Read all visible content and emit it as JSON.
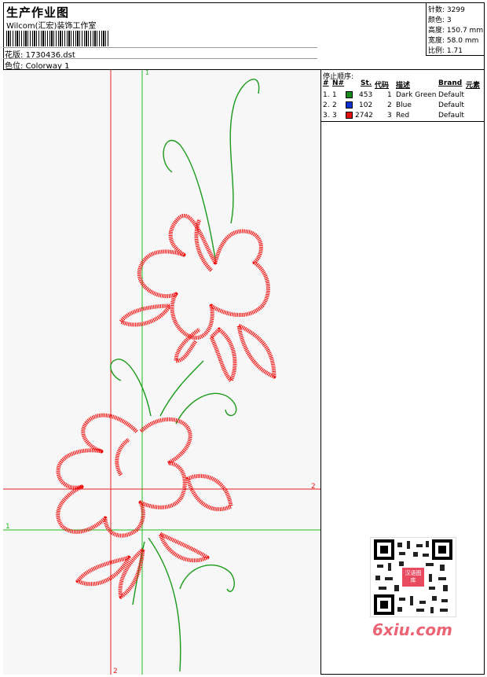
{
  "header": {
    "title": "生产作业图",
    "company": "Wilcom(汇宏)装饰工作室",
    "design_label": "花版:",
    "design_value": "1730436.dst",
    "color_label": "色位:",
    "color_value": "Colorway 1"
  },
  "stats": [
    {
      "label": "针数:",
      "value": "3299"
    },
    {
      "label": "颜色:",
      "value": "3"
    },
    {
      "label": "高度:",
      "value": "150.7 mm"
    },
    {
      "label": "宽度:",
      "value": "58.0 mm"
    },
    {
      "label": "比例:",
      "value": "1.71"
    }
  ],
  "markers": {
    "green_v": "1",
    "red_h": "2",
    "green_h": "1",
    "red_v": "2"
  },
  "stop_sequence": {
    "title": "停止顺序:",
    "columns": [
      "#",
      "N#",
      "St.",
      "代码",
      "描述",
      "Brand",
      "元素"
    ],
    "rows": [
      {
        "idx": "1.",
        "n": "1",
        "stitches": "453",
        "code": "1",
        "desc": "Dark Green",
        "brand": "Default",
        "color": "#1a8a1a"
      },
      {
        "idx": "2.",
        "n": "2",
        "stitches": "102",
        "code": "2",
        "desc": "Blue",
        "brand": "Default",
        "color": "#1030d0"
      },
      {
        "idx": "3.",
        "n": "3",
        "stitches": "2742",
        "code": "3",
        "desc": "Red",
        "brand": "Default",
        "color": "#e01010"
      }
    ]
  },
  "watermark": "6xiu.com",
  "qr_text": "汉语图库"
}
